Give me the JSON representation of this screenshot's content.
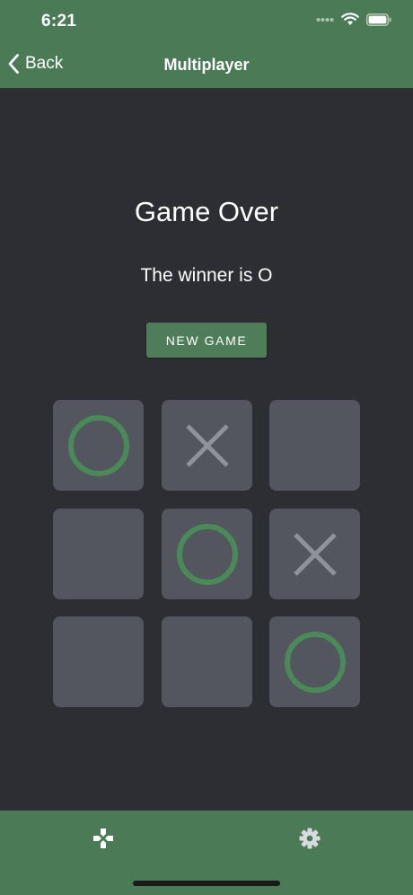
{
  "status_bar": {
    "time": "6:21"
  },
  "nav": {
    "back_label": "Back",
    "title": "Multiplayer"
  },
  "game": {
    "title": "Game Over",
    "winner_text": "The winner is O",
    "new_game_label": "NEW GAME",
    "board": [
      "O",
      "X",
      "",
      "",
      "O",
      "X",
      "",
      "",
      "O"
    ]
  },
  "tabs": [
    {
      "icon": "gamepad-icon"
    },
    {
      "icon": "gear-icon"
    }
  ],
  "colors": {
    "accent": "#4a7b56",
    "background": "#2c2e33",
    "cell": "#53565e",
    "o_mark": "#4a8a58",
    "x_mark": "#8f9298"
  }
}
